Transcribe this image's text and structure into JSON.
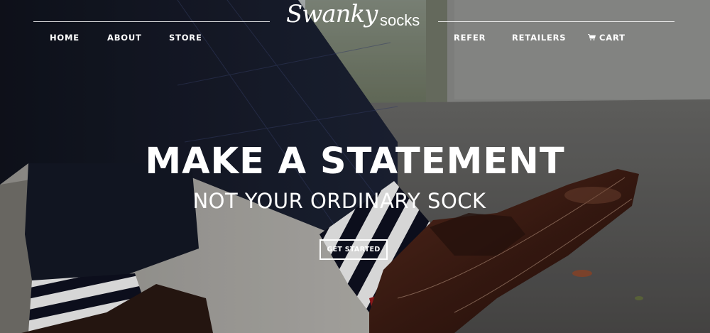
{
  "brand": {
    "script": "Swanky",
    "word": "socks"
  },
  "nav": {
    "left": [
      "HOME",
      "ABOUT",
      "STORE"
    ],
    "right": [
      "REFER",
      "RETAILERS",
      "CART"
    ]
  },
  "hero": {
    "headline": "MAKE A STATEMENT",
    "subheadline": "NOT YOUR ORDINARY SOCK",
    "cta_label": "GET STARTED"
  },
  "icons": {
    "cart": "shopping-cart-icon"
  },
  "colors": {
    "text": "#ffffff",
    "shoe": "#4a2418",
    "trousers": "#151a2a"
  }
}
